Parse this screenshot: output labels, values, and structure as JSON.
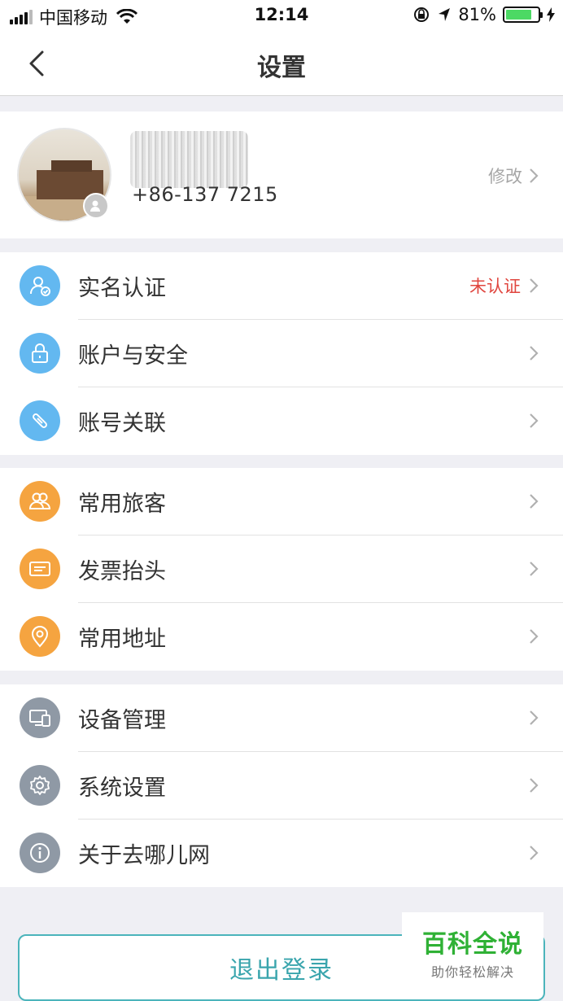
{
  "status_bar": {
    "carrier": "中国移动",
    "time": "12:14",
    "battery_percent": "81%",
    "battery_level": 0.81
  },
  "nav": {
    "title": "设置",
    "back_icon": "chevron-left-icon"
  },
  "profile": {
    "phone": "+86-137 7215",
    "modify_label": "修改"
  },
  "groups": [
    {
      "items": [
        {
          "label": "实名认证",
          "icon": "identity-check-icon",
          "color": "#63b8f0",
          "badge": "未认证"
        },
        {
          "label": "账户与安全",
          "icon": "lock-icon",
          "color": "#63b8f0"
        },
        {
          "label": "账号关联",
          "icon": "link-icon",
          "color": "#63b8f0"
        }
      ]
    },
    {
      "items": [
        {
          "label": "常用旅客",
          "icon": "users-icon",
          "color": "#f5a440"
        },
        {
          "label": "发票抬头",
          "icon": "invoice-icon",
          "color": "#f5a440"
        },
        {
          "label": "常用地址",
          "icon": "location-pin-icon",
          "color": "#f5a440"
        }
      ]
    },
    {
      "items": [
        {
          "label": "设备管理",
          "icon": "devices-icon",
          "color": "#8f99a5"
        },
        {
          "label": "系统设置",
          "icon": "gear-icon",
          "color": "#8f99a5"
        },
        {
          "label": "关于去哪儿网",
          "icon": "info-icon",
          "color": "#8f99a5"
        }
      ]
    }
  ],
  "logout_label": "退出登录",
  "watermark": {
    "title": "百科全说",
    "subtitle": "助你轻松解决"
  },
  "colors": {
    "badge_red": "#e0463f",
    "logout_teal": "#3aa5ad",
    "watermark_green": "#2fb135"
  }
}
